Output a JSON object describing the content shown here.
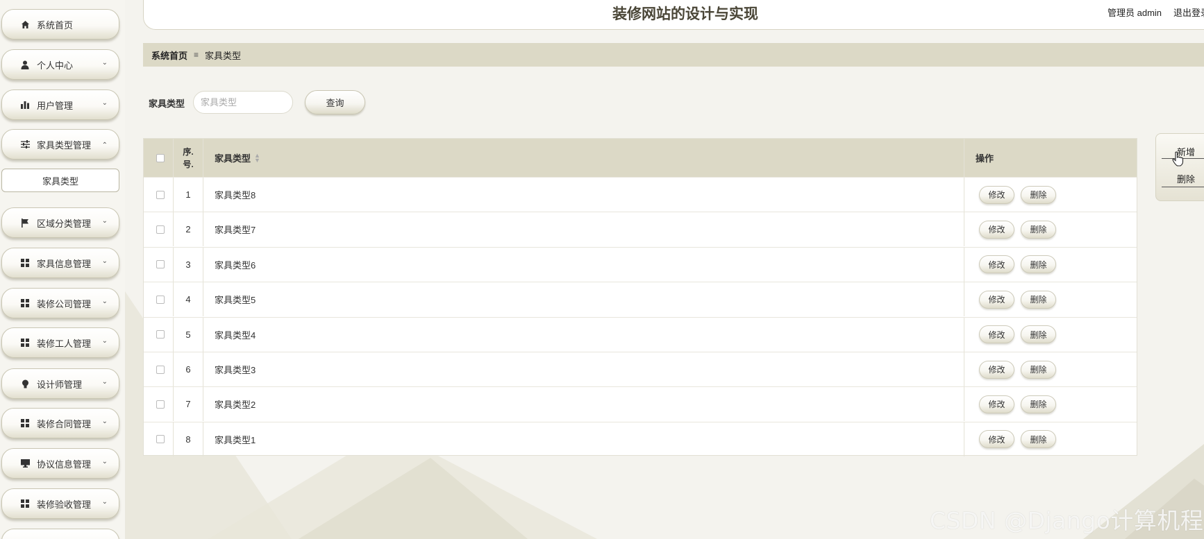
{
  "colors": {
    "accent": "#dcd9c6",
    "background": "#f4f3ee",
    "button_border": "#c9c6b3"
  },
  "sidebar": {
    "items": [
      {
        "label": "系统首页",
        "icon": "home-icon",
        "expandable": false
      },
      {
        "label": "个人中心",
        "icon": "user-icon",
        "expandable": true
      },
      {
        "label": "用户管理",
        "icon": "bar-chart-icon",
        "expandable": true
      },
      {
        "label": "家具类型管理",
        "icon": "sliders-icon",
        "expandable": true,
        "expanded": true
      },
      {
        "label": "区域分类管理",
        "icon": "flag-icon",
        "expandable": true
      },
      {
        "label": "家具信息管理",
        "icon": "grid-icon",
        "expandable": true
      },
      {
        "label": "装修公司管理",
        "icon": "grid-icon",
        "expandable": true
      },
      {
        "label": "装修工人管理",
        "icon": "grid-icon",
        "expandable": true
      },
      {
        "label": "设计师管理",
        "icon": "bulb-icon",
        "expandable": true
      },
      {
        "label": "装修合同管理",
        "icon": "grid-icon",
        "expandable": true
      },
      {
        "label": "协议信息管理",
        "icon": "monitor-icon",
        "expandable": true
      },
      {
        "label": "装修验收管理",
        "icon": "grid-icon",
        "expandable": true
      }
    ],
    "submenu": {
      "label": "家具类型"
    }
  },
  "header": {
    "title": "装修网站的设计与实现",
    "user": "管理员 admin",
    "logout": "退出登录"
  },
  "breadcrumb": {
    "home": "系统首页",
    "current": "家具类型"
  },
  "search": {
    "label": "家具类型",
    "placeholder": "家具类型",
    "value": "",
    "button": "查询"
  },
  "table": {
    "headers": {
      "index": "序号",
      "index_line1": "序.",
      "index_line2": "号.",
      "type": "家具类型",
      "actions": "操作"
    },
    "rows": [
      {
        "index": "1",
        "type": "家具类型8"
      },
      {
        "index": "2",
        "type": "家具类型7"
      },
      {
        "index": "3",
        "type": "家具类型6"
      },
      {
        "index": "4",
        "type": "家具类型5"
      },
      {
        "index": "5",
        "type": "家具类型4"
      },
      {
        "index": "6",
        "type": "家具类型3"
      },
      {
        "index": "7",
        "type": "家具类型2"
      },
      {
        "index": "8",
        "type": "家具类型1"
      }
    ],
    "edit_label": "修改",
    "delete_label": "删除"
  },
  "panel": {
    "add": "新增",
    "delete": "删除"
  },
  "watermark": "CSDN @Django计算机程序"
}
